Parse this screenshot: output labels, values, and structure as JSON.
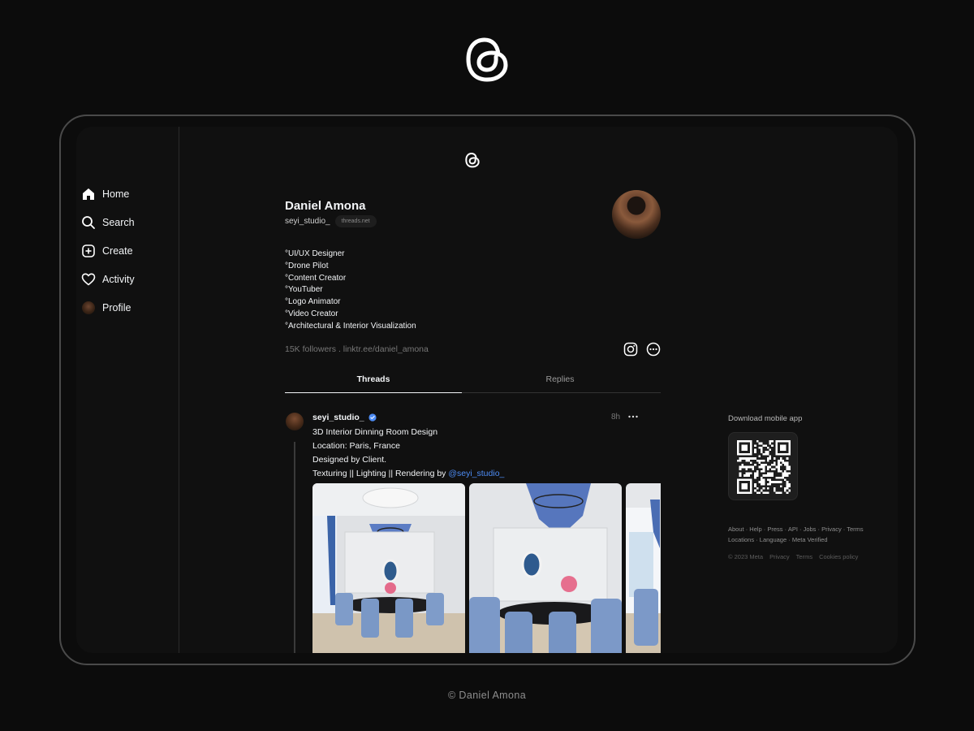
{
  "app": {
    "name": "Threads"
  },
  "sidebar": {
    "items": [
      {
        "label": "Home",
        "icon": "home-icon"
      },
      {
        "label": "Search",
        "icon": "search-icon"
      },
      {
        "label": "Create",
        "icon": "create-icon"
      },
      {
        "label": "Activity",
        "icon": "heart-icon"
      },
      {
        "label": "Profile",
        "icon": "avatar"
      }
    ]
  },
  "profile": {
    "name": "Daniel Amona",
    "handle": "seyi_studio_",
    "domain_badge": "threads.net",
    "bio": [
      "°UI/UX Designer",
      "°Drone Pilot",
      "°Content Creator",
      "°YouTuber",
      "°Logo Animator",
      "°Video Creator",
      "°Architectural & Interior Visualization"
    ],
    "meta": "15K followers . linktr.ee/daniel_amona"
  },
  "tabs": [
    {
      "label": "Threads",
      "active": true
    },
    {
      "label": "Replies",
      "active": false
    }
  ],
  "post": {
    "author": "seyi_studio_",
    "verified": true,
    "time": "8h",
    "lines": [
      "3D Interior Dinning Room Design",
      "Location: Paris, France",
      "Designed by Client.",
      "Texturing || Lighting || Rendering by "
    ],
    "mention": "@seyi_studio_"
  },
  "right": {
    "download_label": "Download mobile app",
    "footer_links": [
      "About",
      "Help",
      "Press",
      "API",
      "Jobs",
      "Privacy",
      "Terms",
      "Locations",
      "Language",
      "Meta Verified"
    ],
    "copyright": "© 2023 Meta",
    "bottom_links": [
      "Privacy",
      "Terms",
      "Cookies policy"
    ]
  },
  "credit": "© Daniel Amona",
  "colors": {
    "background": "#0c0c0c",
    "screen": "#101010",
    "accent": "#4d8cf5",
    "text": "#f3f5f7"
  }
}
